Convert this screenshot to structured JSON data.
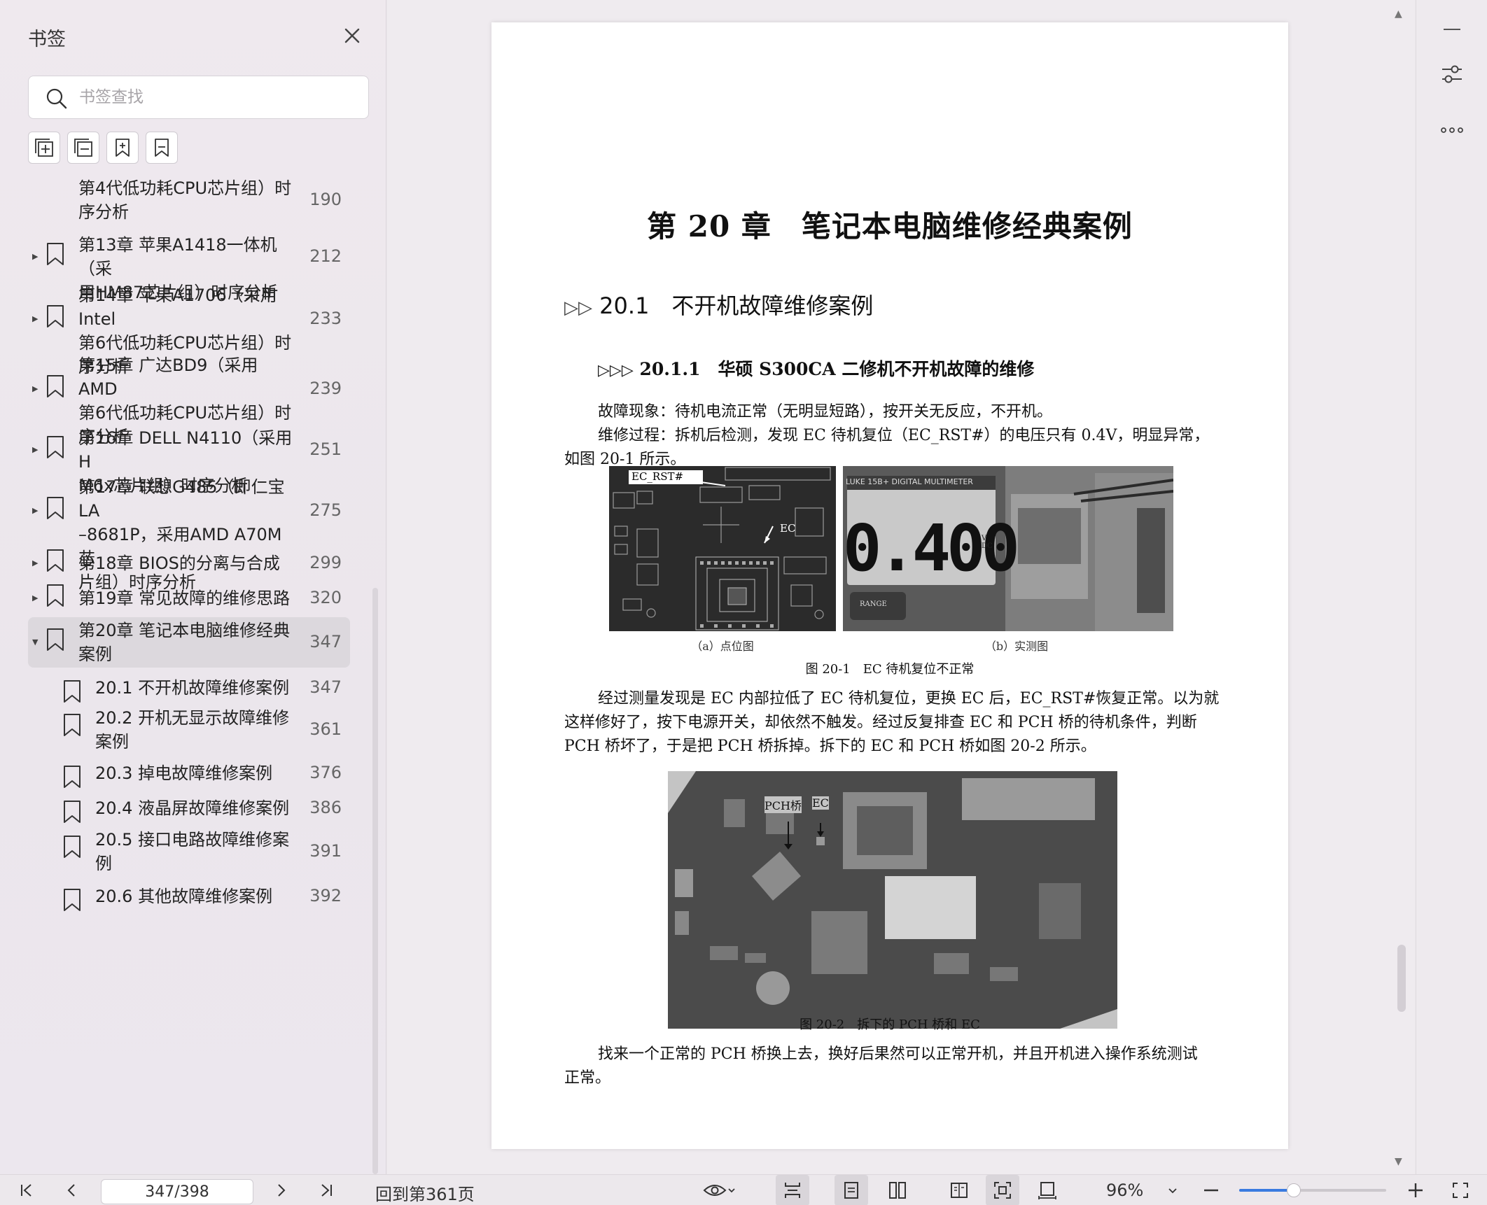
{
  "sidebar": {
    "title": "书签",
    "search_placeholder": "书签查找",
    "tools": [
      "expand-all",
      "collapse-all",
      "add-bookmark",
      "bookmark"
    ],
    "items": [
      {
        "label_lines": [
          "第4代低功耗CPU芯片组）时",
          "序分析"
        ],
        "page": "190",
        "caret": false,
        "icon": false,
        "indent": 0
      },
      {
        "label_lines": [
          "第13章 苹果A1418一体机（采",
          "用HM87芯片组）时序分析"
        ],
        "page": "212",
        "caret": true,
        "icon": true,
        "indent": 0
      },
      {
        "label_lines": [
          "第14章 苹果A1706（采用Intel",
          "第6代低功耗CPU芯片组）时",
          "序分析"
        ],
        "page": "233",
        "caret": true,
        "icon": true,
        "indent": 0
      },
      {
        "label_lines": [
          "第15章 广达BD9（采用AMD",
          "第6代低功耗CPU芯片组）时",
          "序分析"
        ],
        "page": "239",
        "caret": true,
        "icon": true,
        "indent": 0
      },
      {
        "label_lines": [
          "第16章 DELL N4110（采用H",
          "M6x芯片组）时序分析"
        ],
        "page": "251",
        "caret": true,
        "icon": true,
        "indent": 0
      },
      {
        "label_lines": [
          "第17章 联想G485（即仁宝LA",
          "–8681P，采用AMD A70M芯",
          "片组）时序分析"
        ],
        "page": "275",
        "caret": true,
        "icon": true,
        "indent": 0
      },
      {
        "label_lines": [
          "第18章 BIOS的分离与合成"
        ],
        "page": "299",
        "caret": true,
        "icon": true,
        "indent": 0
      },
      {
        "label_lines": [
          "第19章 常见故障的维修思路"
        ],
        "page": "320",
        "caret": true,
        "icon": true,
        "indent": 0
      },
      {
        "label_lines": [
          "第20章 笔记本电脑维修经典",
          "案例"
        ],
        "page": "347",
        "caret": true,
        "icon": true,
        "indent": 0,
        "expanded": true,
        "active": true
      },
      {
        "label_lines": [
          "20.1 不开机故障维修案例"
        ],
        "page": "347",
        "caret": false,
        "icon": true,
        "indent": 1
      },
      {
        "label_lines": [
          "20.2 开机无显示故障维修",
          "案例"
        ],
        "page": "361",
        "caret": false,
        "icon": true,
        "indent": 1
      },
      {
        "label_lines": [
          "20.3 掉电故障维修案例"
        ],
        "page": "376",
        "caret": false,
        "icon": true,
        "indent": 1
      },
      {
        "label_lines": [
          "20.4 液晶屏故障维修案例"
        ],
        "page": "386",
        "caret": false,
        "icon": true,
        "indent": 1
      },
      {
        "label_lines": [
          "20.5 接口电路故障维修案",
          "例"
        ],
        "page": "391",
        "caret": false,
        "icon": true,
        "indent": 1
      },
      {
        "label_lines": [
          "20.6 其他故障维修案例"
        ],
        "page": "392",
        "caret": false,
        "icon": true,
        "indent": 1
      }
    ]
  },
  "document": {
    "chapter_title": "第 20 章　笔记本电脑维修经典案例",
    "section_marker": "▷▷",
    "section_title": "20.1　不开机故障维修案例",
    "subsection_marker": "▷▷▷",
    "subsection_title": "20.1.1　华硕 S300CA 二修机不开机故障的维修",
    "p1": "故障现象：待机电流正常（无明显短路），按开关无反应，不开机。",
    "p2_line1": "维修过程：拆机后检测，发现 EC 待机复位（EC_RST#）的电压只有 0.4V，明显异常，",
    "p2_line2": "如图 20-1 所示。",
    "fig1_label_ec_rst": "EC_RST#",
    "fig1_label_ec": "EC",
    "fig1_meter": "0.400",
    "fig1_meter_unit": "V DC",
    "fig1_meter_brand": "LUKE 15B+ DIGITAL MULTIMETER",
    "fig1_meter_range": "RANGE",
    "sub_caption_a": "（a）点位图",
    "sub_caption_b": "（b）实测图",
    "fig1_caption": "图 20-1　EC 待机复位不正常",
    "p3_line1": "经过测量发现是 EC 内部拉低了 EC 待机复位，更换 EC 后，EC_RST#恢复正常。以为就",
    "p3_line2": "这样修好了，按下电源开关，却依然不触发。经过反复排查 EC 和 PCH 桥的待机条件，判断",
    "p3_line3": "PCH 桥坏了，于是把 PCH 桥拆掉。拆下的 EC 和 PCH 桥如图 20-2 所示。",
    "fig2_label_pch": "PCH桥",
    "fig2_label_ec": "EC",
    "fig2_caption": "图 20-2　拆下的 PCH 桥和 EC",
    "p4_line1": "找来一个正常的 PCH 桥换上去，换好后果然可以正常开机，并且开机进入操作系统测试",
    "p4_line2": "正常。"
  },
  "bottombar": {
    "page_value": "347/398",
    "goto_label": "回到第361页",
    "zoom": "96%",
    "zoom_level": 0.37
  },
  "colors": {
    "accent": "#3a7be0",
    "active_row": "#dcd8dd",
    "sidebar_bg": "#ece7ee",
    "page_bg": "#ffffff"
  }
}
